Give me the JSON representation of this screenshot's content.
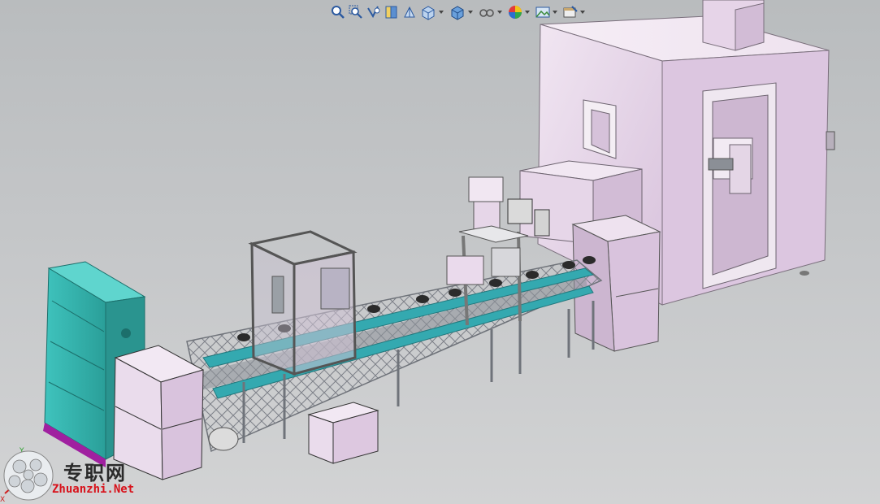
{
  "app": {
    "window": "SolidWorks 3D model viewport"
  },
  "heads_up_toolbar": {
    "items": [
      {
        "name": "zoom-to-fit-icon"
      },
      {
        "name": "zoom-to-area-icon"
      },
      {
        "name": "previous-view-icon"
      },
      {
        "name": "section-view-icon"
      },
      {
        "name": "dynamic-annotation-views-icon"
      },
      {
        "name": "view-orientation-icon",
        "has_dropdown": true
      },
      {
        "name": "display-style-icon",
        "has_dropdown": true
      },
      {
        "name": "hide-show-items-icon",
        "has_dropdown": true
      },
      {
        "name": "edit-appearance-icon",
        "has_dropdown": true
      },
      {
        "name": "apply-scene-icon",
        "has_dropdown": true
      },
      {
        "name": "view-settings-icon",
        "has_dropdown": true
      }
    ]
  },
  "triad": {
    "y": "Y",
    "x": "X"
  },
  "watermark": {
    "chinese": "专职网",
    "url": "Zhuanzhi.Net"
  },
  "colors": {
    "background_top": "#b9bcbe",
    "background_bottom": "#d2d3d4",
    "enclosure": "#e8d8ea",
    "conveyor_teal": "#34a9b0",
    "control_cabinet": "#3fc3bd",
    "frame_gray": "#6f737a",
    "base_purple": "#a020a0",
    "watermark_red": "#d8121b"
  }
}
